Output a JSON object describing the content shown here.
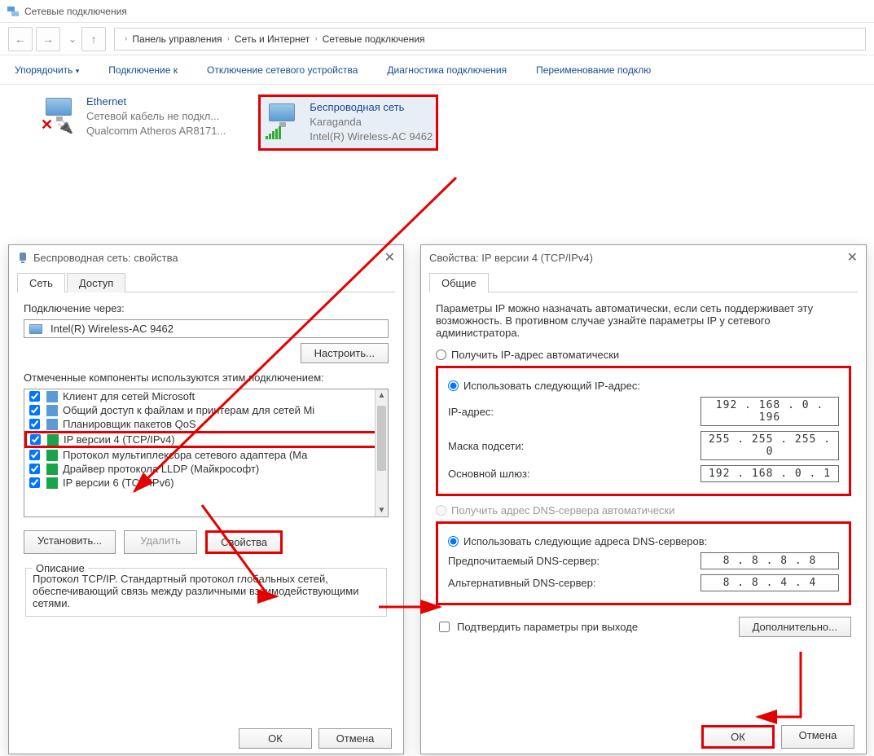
{
  "window": {
    "title": "Сетевые подключения"
  },
  "breadcrumb": {
    "item1": "Панель управления",
    "item2": "Сеть и Интернет",
    "item3": "Сетевые подключения"
  },
  "toolbar": {
    "organize": "Упорядочить",
    "connect": "Подключение к",
    "disable": "Отключение сетевого устройства",
    "diagnose": "Диагностика подключения",
    "rename": "Переименование подклю"
  },
  "adapters": {
    "ethernet": {
      "name": "Ethernet",
      "status": "Сетевой кабель не подкл...",
      "device": "Qualcomm Atheros AR8171..."
    },
    "wifi": {
      "name": "Беспроводная сеть",
      "status": "Karaganda",
      "device": "Intel(R) Wireless-AC 9462"
    }
  },
  "props": {
    "title": "Беспроводная сеть: свойства",
    "tabs": {
      "network": "Сеть",
      "sharing": "Доступ"
    },
    "connect_using_label": "Подключение через:",
    "connect_using_value": "Intel(R) Wireless-AC 9462",
    "configure_btn": "Настроить...",
    "components_label": "Отмеченные компоненты используются этим подключением:",
    "components": [
      {
        "label": "Клиент для сетей Microsoft",
        "icon": "net"
      },
      {
        "label": "Общий доступ к файлам и принтерам для сетей Mi",
        "icon": "file"
      },
      {
        "label": "Планировщик пакетов QoS",
        "icon": "qos"
      },
      {
        "label": "IP версии 4 (TCP/IPv4)",
        "icon": "proto",
        "highlight": true
      },
      {
        "label": "Протокол мультиплексора сетевого адаптера (Ма",
        "icon": "proto"
      },
      {
        "label": "Драйвер протокола LLDP (Майкрософт)",
        "icon": "proto"
      },
      {
        "label": "IP версии 6 (TCP/IPv6)",
        "icon": "proto"
      }
    ],
    "install_btn": "Установить...",
    "remove_btn": "Удалить",
    "props_btn": "Свойства",
    "desc_label": "Описание",
    "desc_text": "Протокол TCP/IP. Стандартный протокол глобальных сетей, обеспечивающий связь между различными взаимодействующими сетями.",
    "ok": "ОК",
    "cancel": "Отмена"
  },
  "ipv4": {
    "title": "Свойства: IP версии 4 (TCP/IPv4)",
    "tab_general": "Общие",
    "intro": "Параметры IP можно назначать автоматически, если сеть поддерживает эту возможность. В противном случае узнайте параметры IP у сетевого администратора.",
    "radio_auto_ip": "Получить IP-адрес автоматически",
    "radio_use_ip": "Использовать следующий IP-адрес:",
    "ip_label": "IP-адрес:",
    "ip_value": "192 . 168 .  0  . 196",
    "mask_label": "Маска подсети:",
    "mask_value": "255 . 255 . 255 .  0",
    "gw_label": "Основной шлюз:",
    "gw_value": "192 . 168 .  0  .  1",
    "radio_auto_dns": "Получить адрес DNS-сервера автоматически",
    "radio_use_dns": "Использовать следующие адреса DNS-серверов:",
    "dns1_label": "Предпочитаемый DNS-сервер:",
    "dns1_value": "8  .  8  .  8  .  8",
    "dns2_label": "Альтернативный DNS-сервер:",
    "dns2_value": "8  .  8  .  4  .  4",
    "validate_cb": "Подтвердить параметры при выходе",
    "advanced_btn": "Дополнительно...",
    "ok": "ОК",
    "cancel": "Отмена"
  }
}
